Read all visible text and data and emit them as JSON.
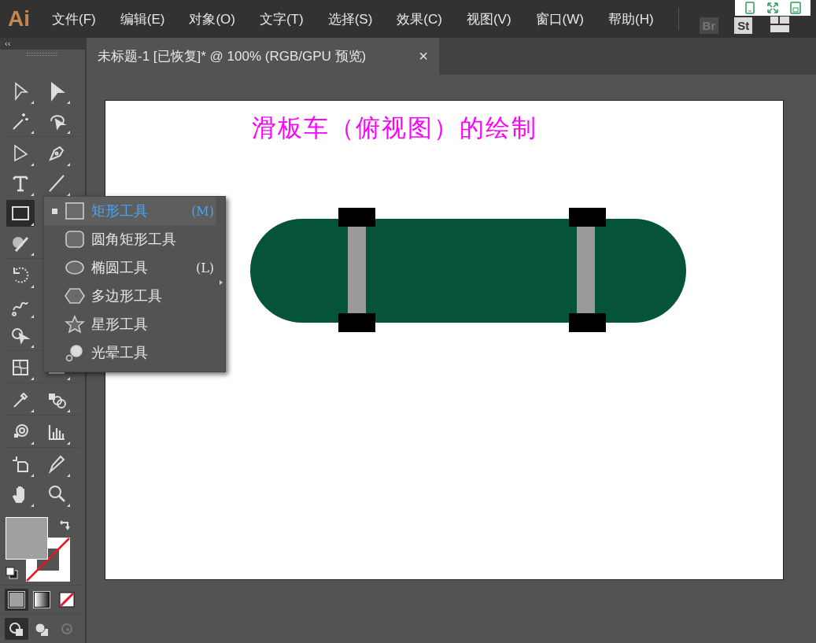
{
  "app": {
    "logo": "Ai"
  },
  "menu": [
    "文件(F)",
    "编辑(E)",
    "对象(O)",
    "文字(T)",
    "选择(S)",
    "效果(C)",
    "视图(V)",
    "窗口(W)",
    "帮助(H)"
  ],
  "app_buttons": [
    {
      "label": "Br",
      "disabled": true
    },
    {
      "label": "St",
      "disabled": false
    }
  ],
  "document_tab": {
    "title": "未标题-1 [已恢复]* @ 100% (RGB/GPU 预览)",
    "close": "×"
  },
  "panel_collapse": "‹‹",
  "toolbar": [
    [
      {
        "kind": "select",
        "selected": false
      },
      {
        "kind": "direct-select",
        "selected": false
      }
    ],
    [
      {
        "kind": "magic-wand",
        "selected": false
      },
      {
        "kind": "lasso",
        "selected": false
      }
    ],
    [
      {
        "kind": "anchor",
        "selected": false
      },
      {
        "kind": "pen",
        "selected": false
      }
    ],
    [
      {
        "kind": "type",
        "selected": false
      },
      {
        "kind": "line",
        "selected": false
      }
    ],
    [
      {
        "kind": "rectangle",
        "selected": true
      }
    ],
    [
      {
        "kind": "shaper",
        "selected": false
      }
    ],
    [
      {
        "kind": "rotate",
        "selected": false
      }
    ],
    [
      {
        "kind": "warp",
        "selected": false
      }
    ],
    [
      {
        "kind": "shape-builder",
        "selected": false
      }
    ],
    [
      {
        "kind": "mesh",
        "selected": false
      },
      {
        "kind": "gradient",
        "selected": false
      }
    ],
    [
      {
        "kind": "eyedropper",
        "selected": false
      },
      {
        "kind": "blend",
        "selected": false
      }
    ],
    [
      {
        "kind": "sprayer",
        "selected": false
      },
      {
        "kind": "graph",
        "selected": false
      }
    ],
    [
      {
        "kind": "artboard",
        "selected": false
      },
      {
        "kind": "pencil",
        "selected": false
      }
    ],
    [
      {
        "kind": "hand",
        "selected": false
      },
      {
        "kind": "zoom",
        "selected": false
      }
    ]
  ],
  "color_modes": [
    {
      "kind": "color",
      "selected": true
    },
    {
      "kind": "gradient",
      "selected": false
    },
    {
      "kind": "none",
      "selected": false
    }
  ],
  "draw_modes": [
    {
      "kind": "normal",
      "selected": true,
      "disabled": false
    },
    {
      "kind": "behind",
      "selected": false,
      "disabled": false
    },
    {
      "kind": "inside",
      "selected": false,
      "disabled": true
    }
  ],
  "flyout": [
    {
      "kind": "rectangle",
      "label": "矩形工具",
      "shortcut": "(M)",
      "selected": true
    },
    {
      "kind": "rounded-rectangle",
      "label": "圆角矩形工具",
      "selected": false
    },
    {
      "kind": "ellipse",
      "label": "椭圆工具",
      "shortcut": "(L)",
      "selected": false
    },
    {
      "kind": "polygon",
      "label": "多边形工具",
      "selected": false
    },
    {
      "kind": "star",
      "label": "星形工具",
      "selected": false
    },
    {
      "kind": "flare",
      "label": "光晕工具",
      "selected": false
    }
  ],
  "artboard": {
    "title": "滑板车（俯视图）的绘制"
  }
}
